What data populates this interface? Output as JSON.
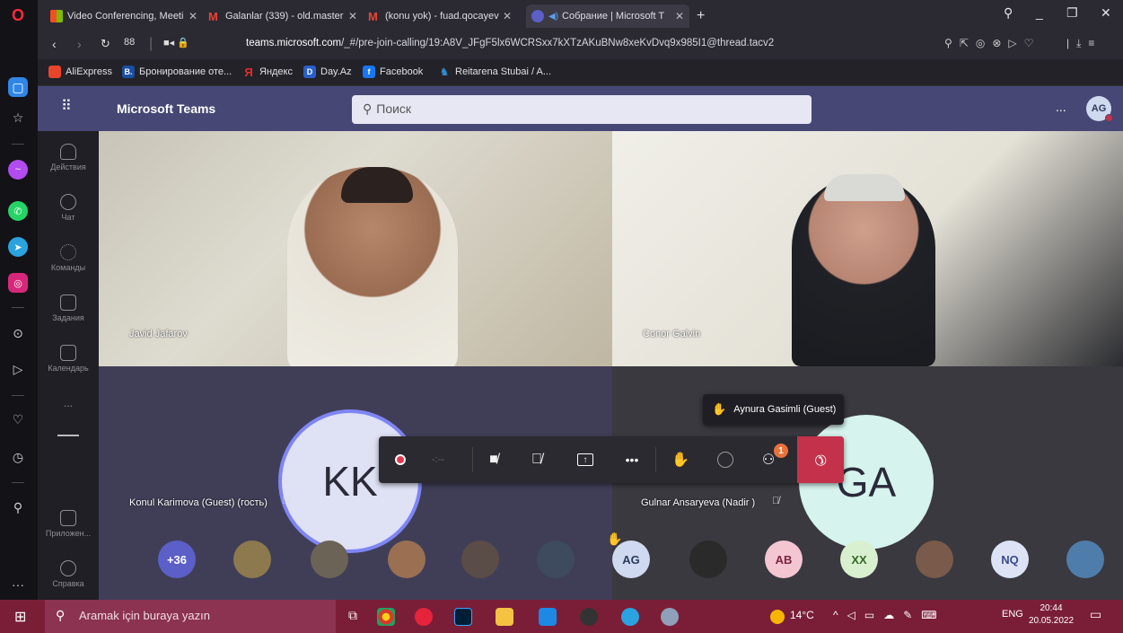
{
  "browser": {
    "tabs": [
      {
        "label": "Video Conferencing, Meeti",
        "active": false
      },
      {
        "label": "Galanlar (339) - old.master",
        "active": false
      },
      {
        "label": "(konu yok) - fuad.qocayev",
        "active": false
      },
      {
        "label": "Собрание | Microsoft T",
        "active": true
      }
    ],
    "new_tab": "+",
    "url_host": "teams.microsoft.com",
    "url_rest": "/_#/pre-join-calling/19:A8V_JFgF5lx6WCRSxx7kXTzAKuBNw8xeKvDvq9x985I1@thread.tacv2",
    "bookmarks": [
      {
        "label": "AliExpress",
        "color": "#e8452c",
        "glyph": "A"
      },
      {
        "label": "Бронирование оте...",
        "color": "#1a4fa3",
        "glyph": "B."
      },
      {
        "label": "Яндекс",
        "color": "#e42d2d",
        "glyph": "Я"
      },
      {
        "label": "Day.Az",
        "color": "#2a5fc9",
        "glyph": "D"
      },
      {
        "label": "Facebook",
        "color": "#1877f2",
        "glyph": "f"
      },
      {
        "label": "Reitarena Stubai / A...",
        "color": "#2f8fd6",
        "glyph": "R"
      }
    ]
  },
  "teams": {
    "app_name": "Microsoft Teams",
    "search_placeholder": "Поиск",
    "more": "...",
    "user_initials": "AG",
    "rail": [
      {
        "label": "Действия",
        "icon": "bell-icon"
      },
      {
        "label": "Чат",
        "icon": "chat-icon"
      },
      {
        "label": "Команды",
        "icon": "teams-icon"
      },
      {
        "label": "Задания",
        "icon": "assignments-icon"
      },
      {
        "label": "Календарь",
        "icon": "calendar-icon"
      },
      {
        "label": "Приложен...",
        "icon": "apps-icon"
      },
      {
        "label": "Справка",
        "icon": "help-icon"
      }
    ],
    "rail_more": "...",
    "participants": {
      "video1": "Javid Jafarov",
      "video2": "Conor Galvin",
      "tile3": "Konul Karimova (Guest) (гость)",
      "tile3_initials": "KK",
      "tile4": "Gulnar Ansaryeva (Nadir )",
      "tile4_initials": "GA"
    },
    "tooltip": "Aynura Gasimli (Guest)",
    "participants_badge": "1",
    "roster": [
      {
        "label": "+36",
        "bg": "#5b5fc7",
        "fg": "#ffffff"
      },
      {
        "label": "",
        "bg": "#8c7a4e",
        "fg": "#ffffff"
      },
      {
        "label": "",
        "bg": "#6b6356",
        "fg": "#ffffff"
      },
      {
        "label": "",
        "bg": "#9a6f52",
        "fg": "#ffffff"
      },
      {
        "label": "",
        "bg": "#5a4c47",
        "fg": "#ffffff"
      },
      {
        "label": "",
        "bg": "#3e4a5e",
        "fg": "#ffffff"
      },
      {
        "label": "AG",
        "bg": "#cfd9ef",
        "fg": "#2d3a5c"
      },
      {
        "label": "",
        "bg": "#2a2a2a",
        "fg": "#ffffff"
      },
      {
        "label": "AB",
        "bg": "#f4c6d2",
        "fg": "#7a2340"
      },
      {
        "label": "XX",
        "bg": "#d9f0d0",
        "fg": "#2d6b22"
      },
      {
        "label": "",
        "bg": "#7a5a4a",
        "fg": "#ffffff"
      },
      {
        "label": "NQ",
        "bg": "#dde3f5",
        "fg": "#3b4a8c"
      },
      {
        "label": "",
        "bg": "#4f7dab",
        "fg": "#ffffff"
      }
    ]
  },
  "taskbar": {
    "search_placeholder": "Aramak için buraya yazın",
    "weather": "14°C",
    "language": "ENG",
    "time": "20:44",
    "date": "20.05.2022"
  }
}
